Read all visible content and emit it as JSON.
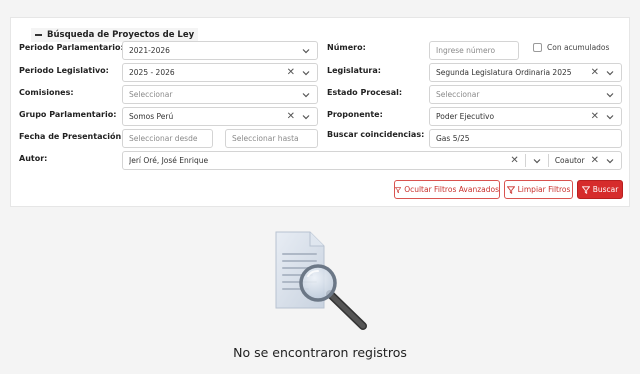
{
  "panel": {
    "legend": "Búsqueda de Proyectos de Ley"
  },
  "filters": {
    "periodo_parlamentario": {
      "label": "Periodo Parlamentario:",
      "value": "2021-2026"
    },
    "numero": {
      "label": "Número:",
      "placeholder": "Ingrese número"
    },
    "con_acumulados": {
      "label": "Con acumulados",
      "checked": false
    },
    "periodo_legislativo": {
      "label": "Periodo Legislativo:",
      "value": "2025 - 2026"
    },
    "legislatura": {
      "label": "Legislatura:",
      "value": "Segunda Legislatura Ordinaria 2025"
    },
    "comisiones": {
      "label": "Comisiones:",
      "placeholder": "Seleccionar"
    },
    "estado_procesal": {
      "label": "Estado Procesal:",
      "placeholder": "Seleccionar"
    },
    "grupo_parlamentario": {
      "label": "Grupo Parlamentario:",
      "value": "Somos Perú"
    },
    "proponente": {
      "label": "Proponente:",
      "value": "Poder Ejecutivo"
    },
    "fecha_presentacion": {
      "label": "Fecha de Presentación:",
      "desde_placeholder": "Seleccionar desde",
      "hasta_placeholder": "Seleccionar hasta"
    },
    "buscar_coincidencias": {
      "label": "Buscar coincidencias:",
      "value": "Gas 5/25"
    },
    "autor": {
      "label": "Autor:",
      "value": "Jerí Oré, José Enrique",
      "tipo": "Coautor"
    }
  },
  "buttons": {
    "ocultar": "Ocultar Filtros Avanzados",
    "limpiar": "Limpiar Filtros",
    "buscar": "Buscar"
  },
  "results": {
    "empty_message": "No se encontraron registros"
  },
  "colors": {
    "accent": "#d62c2c",
    "border": "#d4d4d4"
  }
}
